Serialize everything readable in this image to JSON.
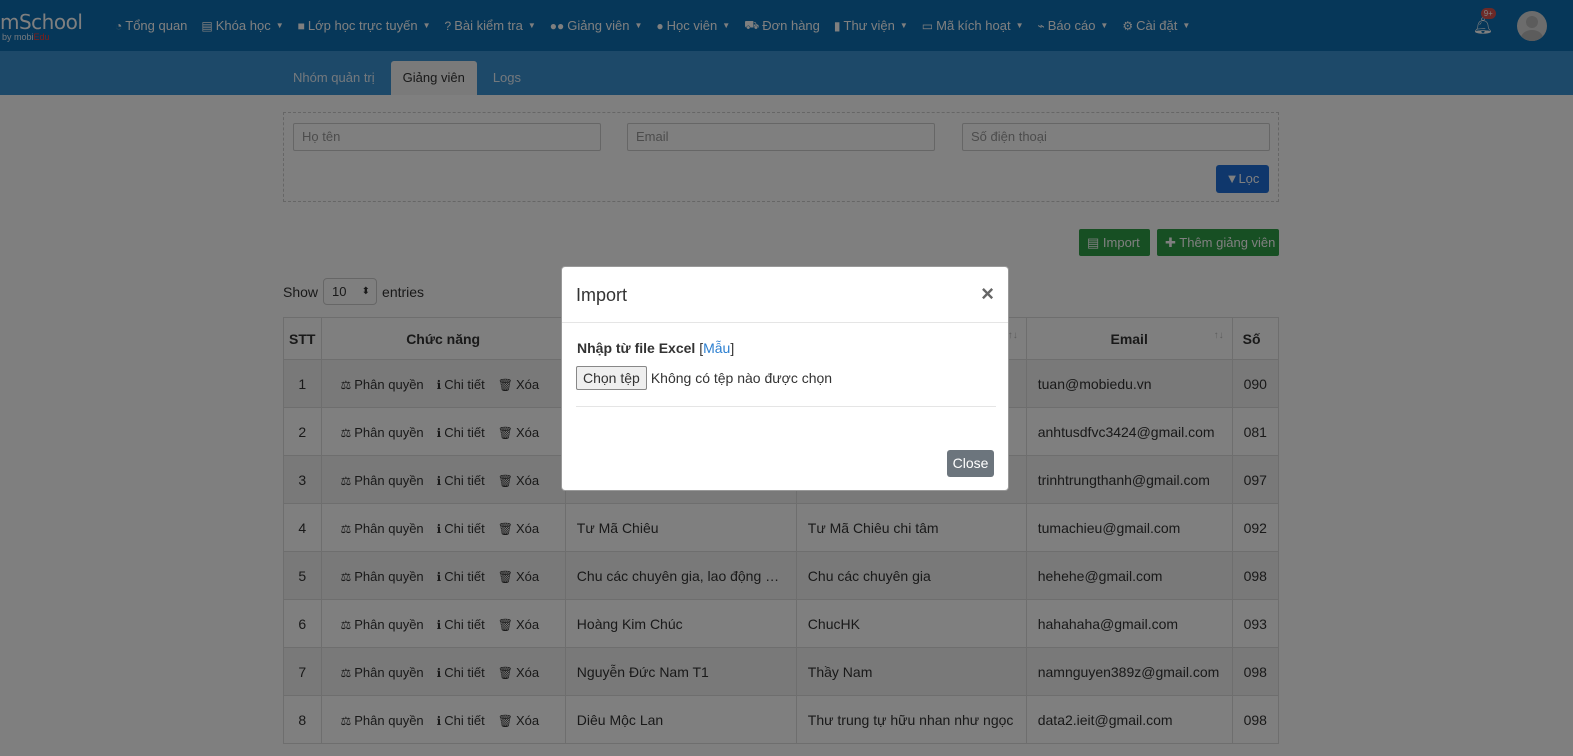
{
  "brand": {
    "logo_main": "mSchool",
    "logo_sub_prefix": "by mobi",
    "logo_sub_suffix": "Edu"
  },
  "nav": [
    {
      "label": "Tổng quan",
      "icon": "dashboard-icon",
      "glyph": "◔",
      "caret": false
    },
    {
      "label": "Khóa học",
      "icon": "list-icon",
      "glyph": "▤",
      "caret": true
    },
    {
      "label": "Lớp học trực tuyến",
      "icon": "video-icon",
      "glyph": "■",
      "caret": true
    },
    {
      "label": "Bài kiểm tra",
      "icon": "question-icon",
      "glyph": "?",
      "caret": true
    },
    {
      "label": "Giảng viên",
      "icon": "users-icon",
      "glyph": "●●",
      "caret": true
    },
    {
      "label": "Học viên",
      "icon": "user-icon",
      "glyph": "●",
      "caret": true
    },
    {
      "label": "Đơn hàng",
      "icon": "cart-icon",
      "glyph": "⛟",
      "caret": false
    },
    {
      "label": "Thư viện",
      "icon": "book-icon",
      "glyph": "▮",
      "caret": true
    },
    {
      "label": "Mã kích hoạt",
      "icon": "credit-card-icon",
      "glyph": "▭",
      "caret": true
    },
    {
      "label": "Báo cáo",
      "icon": "line-chart-icon",
      "glyph": "⌁",
      "caret": true
    },
    {
      "label": "Cài đặt",
      "icon": "cogs-icon",
      "glyph": "⚙",
      "caret": true
    }
  ],
  "notifications": {
    "badge": "9+"
  },
  "tabs": [
    {
      "label": "Nhóm quản trị",
      "active": false
    },
    {
      "label": "Giảng viên",
      "active": true
    },
    {
      "label": "Logs",
      "active": false
    }
  ],
  "filter": {
    "name_placeholder": "Họ tên",
    "email_placeholder": "Email",
    "phone_placeholder": "Số điện thoại",
    "filter_button": "Lọc"
  },
  "actions": {
    "import_button": "Import",
    "add_button": "Thêm giảng viên"
  },
  "entries": {
    "show": "Show",
    "value": "10",
    "suffix": "entries"
  },
  "table": {
    "columns": {
      "stt": "STT",
      "actions": "Chức năng",
      "email": "Email",
      "phone": "Số"
    },
    "action_labels": {
      "permission": "Phân quyền",
      "detail": "Chi tiết",
      "delete": "Xóa"
    },
    "rows": [
      {
        "stt": "1",
        "name": "",
        "display": "",
        "email": "tuan@mobiedu.vn",
        "phone": "090"
      },
      {
        "stt": "2",
        "name": "",
        "display": "",
        "email": "anhtusdfvc3424@gmail.com",
        "phone": "081"
      },
      {
        "stt": "3",
        "name": "",
        "display": "",
        "email": "trinhtrungthanh@gmail.com",
        "phone": "097"
      },
      {
        "stt": "4",
        "name": "Tư Mã Chiêu",
        "display": "Tư Mã Chiêu chi tâm",
        "email": "tumachieu@gmail.com",
        "phone": "092"
      },
      {
        "stt": "5",
        "name": "Chu các chuyên gia, lao động V...",
        "display": "Chu các chuyên gia",
        "email": "hehehe@gmail.com",
        "phone": "098"
      },
      {
        "stt": "6",
        "name": "Hoàng Kim Chúc",
        "display": "ChucHK",
        "email": "hahahaha@gmail.com",
        "phone": "093"
      },
      {
        "stt": "7",
        "name": "Nguyễn Đức Nam T1",
        "display": "Thầy Nam",
        "email": "namnguyen389z@gmail.com",
        "phone": "098"
      },
      {
        "stt": "8",
        "name": "Diêu Mộc Lan",
        "display": "Thư trung tự hữu nhan như ngọc",
        "email": "data2.ieit@gmail.com",
        "phone": "098"
      }
    ]
  },
  "modal": {
    "title": "Import",
    "close_symbol": "×",
    "label": "Nhập từ file Excel",
    "template_link": "Mẫu",
    "bracket_open": "[",
    "bracket_close": "]",
    "file_button": "Chọn tệp",
    "file_status": "Không có tệp nào được chọn",
    "close_button": "Close"
  }
}
